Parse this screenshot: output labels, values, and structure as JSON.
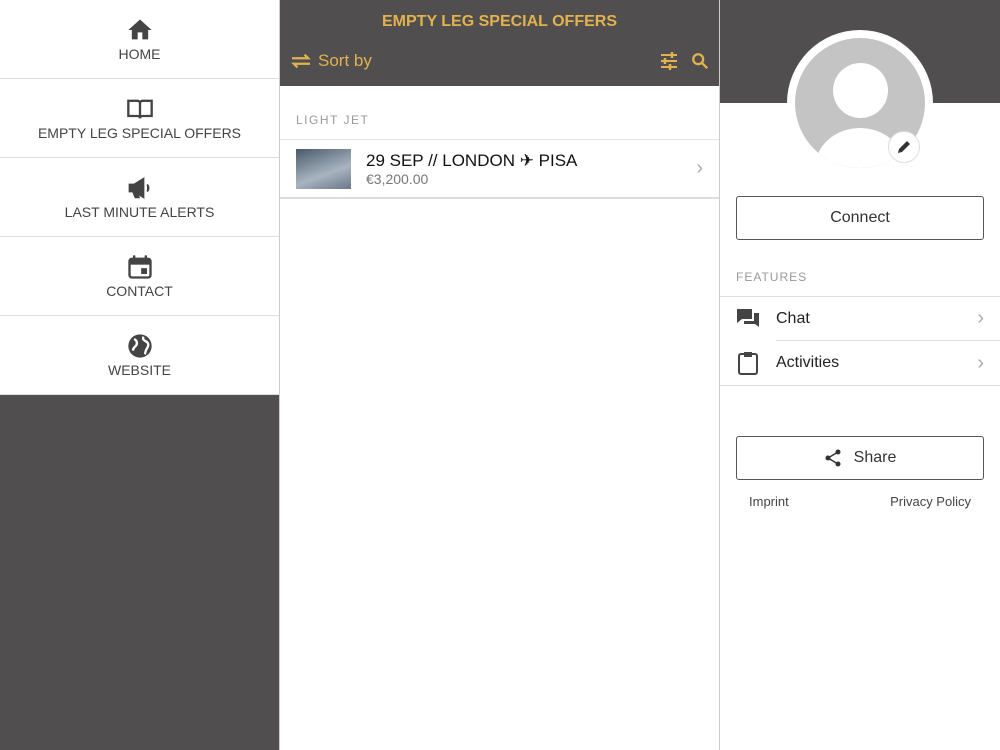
{
  "nav": [
    {
      "label": "HOME",
      "icon": "home-icon"
    },
    {
      "label": "EMPTY LEG SPECIAL OFFERS",
      "icon": "book-icon"
    },
    {
      "label": "LAST MINUTE ALERTS",
      "icon": "megaphone-icon"
    },
    {
      "label": "CONTACT",
      "icon": "calendar-icon"
    },
    {
      "label": "WEBSITE",
      "icon": "globe-icon"
    }
  ],
  "header": {
    "title": "EMPTY LEG SPECIAL OFFERS",
    "sort_label": "Sort by"
  },
  "section": "LIGHT JET",
  "offers": [
    {
      "title": "29 SEP // LONDON ✈ PISA",
      "price": "€3,200.00"
    }
  ],
  "profile": {
    "connect": "Connect",
    "features_label": "FEATURES",
    "features": [
      "Chat",
      "Activities"
    ],
    "share": "Share",
    "imprint": "Imprint",
    "privacy": "Privacy Policy"
  },
  "colors": {
    "accent": "#e2b24f",
    "dark": "#504e4f"
  }
}
